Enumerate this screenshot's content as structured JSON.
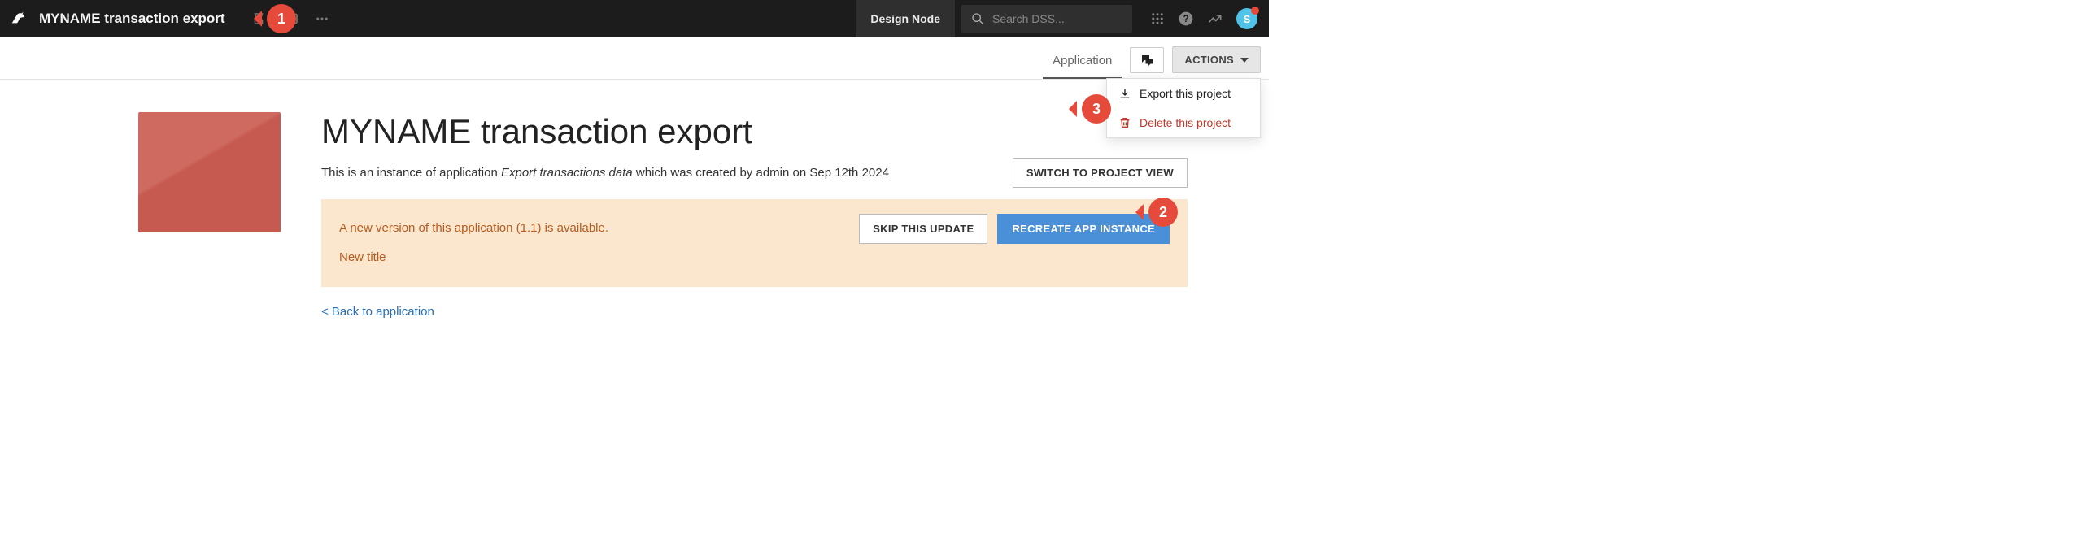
{
  "header": {
    "title": "MYNAME transaction export",
    "design_node": "Design Node",
    "search_placeholder": "Search DSS...",
    "avatar_initial": "S"
  },
  "subbar": {
    "tab_application": "Application",
    "actions_label": "ACTIONS"
  },
  "actions_menu": {
    "export": "Export this project",
    "delete": "Delete this project"
  },
  "page": {
    "title": "MYNAME transaction export",
    "desc_prefix": "This is an instance of application ",
    "desc_app": "Export transactions data",
    "desc_suffix": " which was created by admin on Sep 12th 2024",
    "switch_view": "SWITCH TO PROJECT VIEW",
    "back_link": "< Back to application"
  },
  "notice": {
    "line1": "A new version of this application (1.1) is available.",
    "line2": "New title",
    "skip": "SKIP THIS UPDATE",
    "recreate": "RECREATE APP INSTANCE"
  },
  "callouts": {
    "c1": "1",
    "c2": "2",
    "c3": "3"
  }
}
